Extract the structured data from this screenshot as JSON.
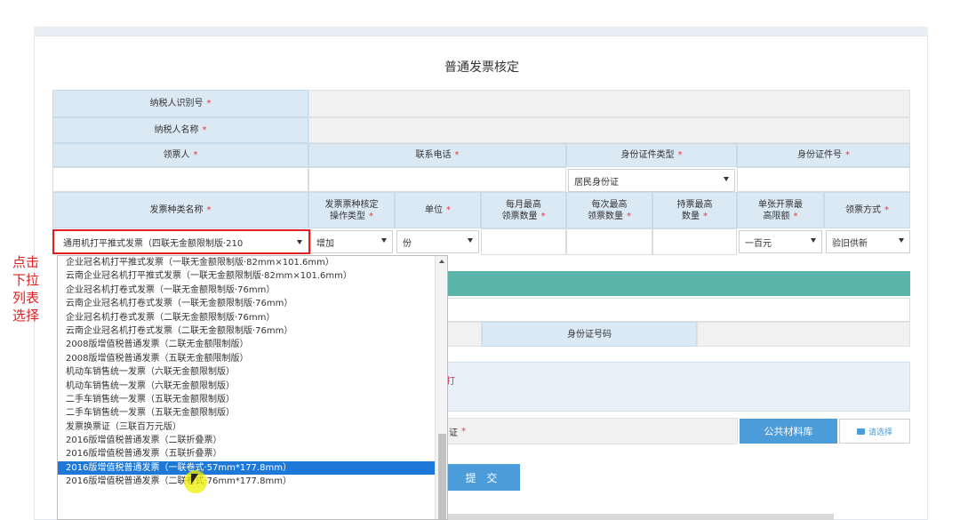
{
  "page_title": "普通发票核定",
  "required_mark": "*",
  "taxpayer": {
    "id_label": "纳税人识别号",
    "name_label": "纳税人名称"
  },
  "headers_row1": {
    "recipient": "领票人",
    "phone": "联系电话",
    "id_type": "身份证件类型",
    "id_no": "身份证件号"
  },
  "id_type_value": "居民身份证",
  "headers_row2": {
    "invoice_type": "发票种类名称",
    "op_type_l1": "发票票种核定",
    "op_type_l2": "操作类型",
    "unit": "单位",
    "monthly_l1": "每月最高",
    "monthly_l2": "领票数量",
    "each_l1": "每次最高",
    "each_l2": "领票数量",
    "hold_l1": "持票最高",
    "hold_l2": "数量",
    "limit_l1": "单张开票最",
    "limit_l2": "高限额",
    "method": "领票方式"
  },
  "row_values": {
    "invoice_type": "通用机打平推式发票（四联无金额限制版·210",
    "op_type": "增加",
    "unit": "份",
    "limit": "一百元",
    "method": "验旧供新"
  },
  "annotation": "点击下拉列表选择",
  "id_number_label": "身份证号码",
  "partial_text_1": "打",
  "partial_text_2": "证",
  "public_library_button": "公共材料库",
  "choose_button": "请选择",
  "submit_button": "提 交",
  "dropdown_items": [
    "企业冠名机打平推式发票（一联无金额限制版·82mm×101.6mm）",
    "云南企业冠名机打平推式发票（一联无金额限制版·82mm×101.6mm）",
    "企业冠名机打卷式发票（一联无金额限制版·76mm）",
    "云南企业冠名机打卷式发票（一联无金额限制版·76mm）",
    "企业冠名机打卷式发票（二联无金额限制版·76mm）",
    "云南企业冠名机打卷式发票（二联无金额限制版·76mm）",
    "2008版增值税普通发票（二联无金额限制版）",
    "2008版增值税普通发票（五联无金额限制版）",
    "机动车销售统一发票（六联无金额限制版）",
    "机动车销售统一发票（六联无金额限制版）",
    "二手车销售统一发票（五联无金额限制版）",
    "二手车销售统一发票（五联无金额限制版）",
    "发票换票证（三联百万元版）",
    "2016版增值税普通发票（二联折叠票）",
    "2016版增值税普通发票（五联折叠票）",
    "2016版增值税普通发票（一联卷式·57mm*177.8mm）",
    "2016版增值税普通发票（二联卷式·76mm*177.8mm）"
  ],
  "highlighted_index": 15
}
